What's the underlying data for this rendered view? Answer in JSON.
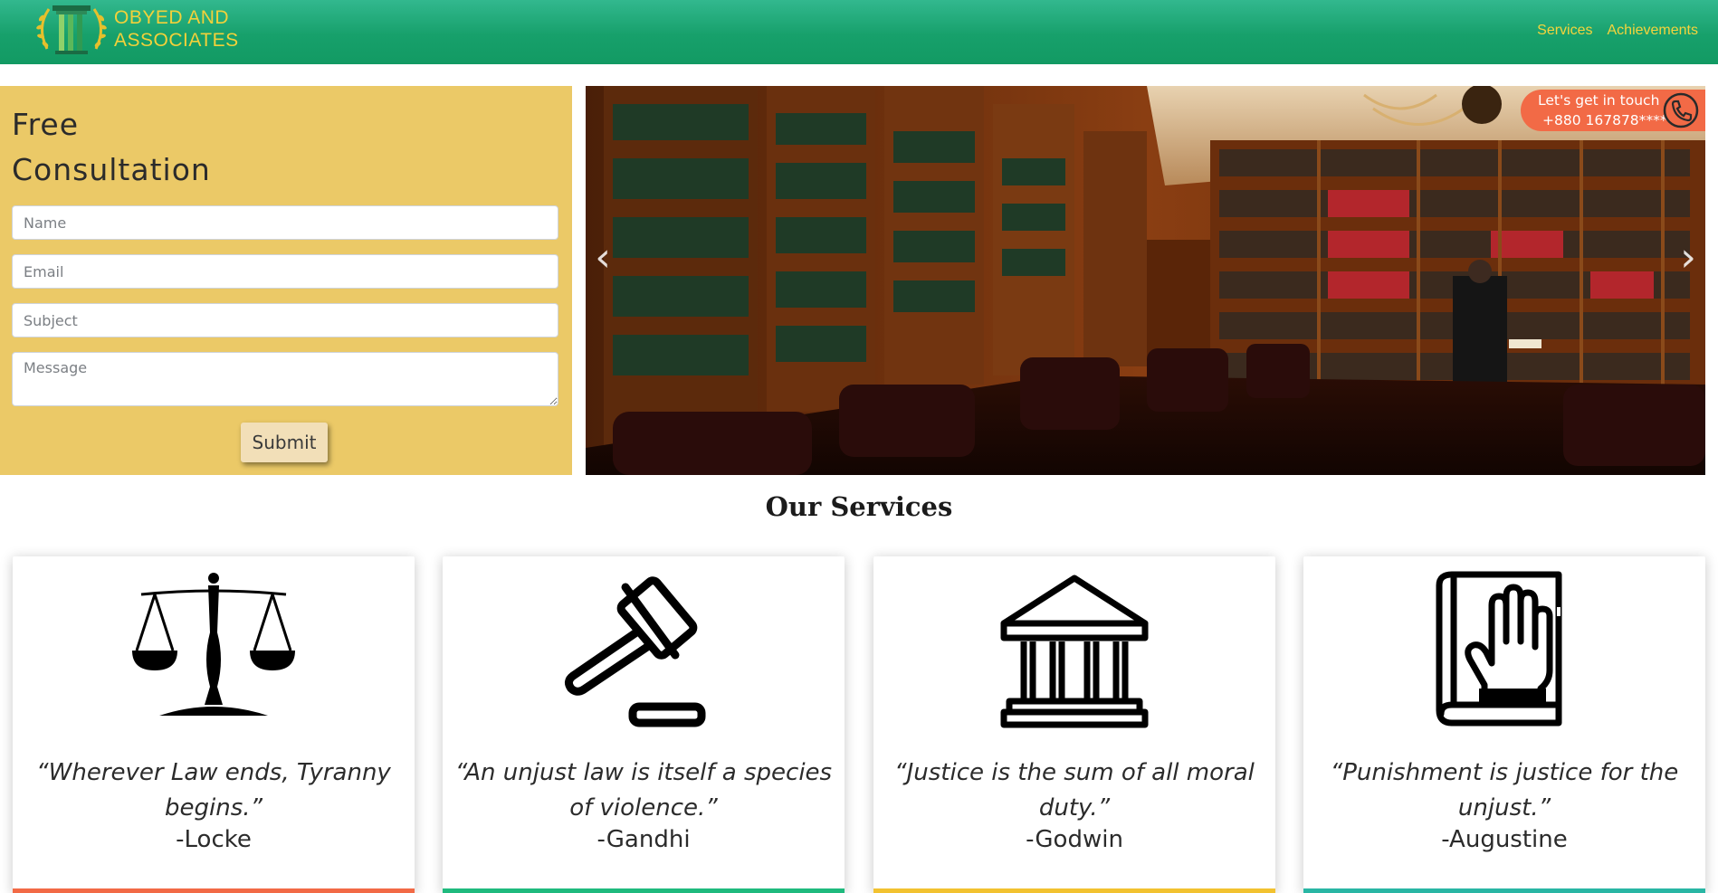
{
  "header": {
    "logo_line1": "OBYED AND",
    "logo_line2": "ASSOCIATES",
    "nav": [
      {
        "label": "Services"
      },
      {
        "label": "Achievements"
      }
    ]
  },
  "consultation": {
    "title_line1": "Free",
    "title_line2": "Consultation",
    "fields": {
      "name_placeholder": "Name",
      "email_placeholder": "Email",
      "subject_placeholder": "Subject",
      "message_placeholder": "Message"
    },
    "submit_label": "Submit"
  },
  "carousel": {
    "prev_icon": "chevron-left-icon",
    "next_icon": "chevron-right-icon",
    "contact_line1": "Let's get in touch",
    "contact_line2": "+880 167878****"
  },
  "services": {
    "title": "Our Services",
    "cards": [
      {
        "icon": "scales-of-justice-icon",
        "quote": "“Wherever Law ends, Tyranny begins.”",
        "author": "-Locke",
        "accent": "#f26a46"
      },
      {
        "icon": "gavel-icon",
        "quote": "“An unjust law is itself a species of violence.”",
        "author": "-Gandhi",
        "accent": "#1fba7e"
      },
      {
        "icon": "courthouse-icon",
        "quote": "“Justice is the sum of all moral duty.”",
        "author": "-Godwin",
        "accent": "#f2c230"
      },
      {
        "icon": "oath-hand-on-book-icon",
        "quote": "“Punishment is justice for the unjust.”",
        "author": "-Augustine",
        "accent": "#29b6a4"
      }
    ]
  },
  "colors": {
    "header_green": "#17a06b",
    "brand_gold": "#f2d13a",
    "form_bg": "#ebc967",
    "contact_orange": "#f26a46"
  }
}
